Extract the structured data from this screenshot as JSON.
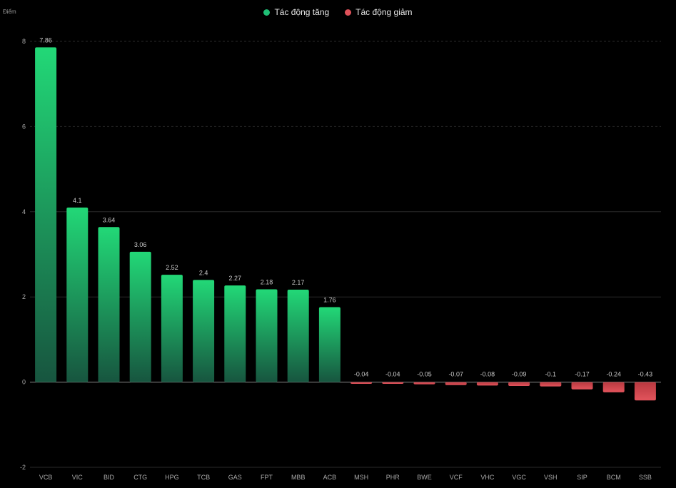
{
  "chart_data": {
    "type": "bar",
    "title": "",
    "xlabel": "",
    "ylabel": "Điểm",
    "ylim": [
      -2,
      8
    ],
    "yticks": [
      -2,
      0,
      2,
      4,
      6,
      8
    ],
    "grid": true,
    "legend_position": "top-center",
    "categories": [
      "VCB",
      "VIC",
      "BID",
      "CTG",
      "HPG",
      "TCB",
      "GAS",
      "FPT",
      "MBB",
      "ACB",
      "MSH",
      "PHR",
      "BWE",
      "VCF",
      "VHC",
      "VGC",
      "VSH",
      "SIP",
      "BCM",
      "SSB"
    ],
    "values": [
      7.86,
      4.1,
      3.64,
      3.06,
      2.52,
      2.4,
      2.27,
      2.18,
      2.17,
      1.76,
      -0.04,
      -0.04,
      -0.05,
      -0.07,
      -0.08,
      -0.09,
      -0.1,
      -0.17,
      -0.24,
      -0.43
    ],
    "data_labels": [
      "7.86",
      "4.1",
      "3.64",
      "3.06",
      "2.52",
      "2.4",
      "2.27",
      "2.18",
      "2.17",
      "1.76",
      "-0.04",
      "-0.04",
      "-0.05",
      "-0.07",
      "-0.08",
      "-0.09",
      "-0.1",
      "-0.17",
      "-0.24",
      "-0.43"
    ],
    "legend": [
      {
        "name": "Tác động tăng",
        "color": "#1fbf76"
      },
      {
        "name": "Tác động giảm",
        "color": "#e0525a"
      }
    ],
    "colors": {
      "positive_top": "#22d877",
      "positive_bottom": "#17553f",
      "negative_top": "#b8383f",
      "negative_bottom": "#e2545c",
      "background": "#000000",
      "grid": "#2a2a2a"
    }
  }
}
